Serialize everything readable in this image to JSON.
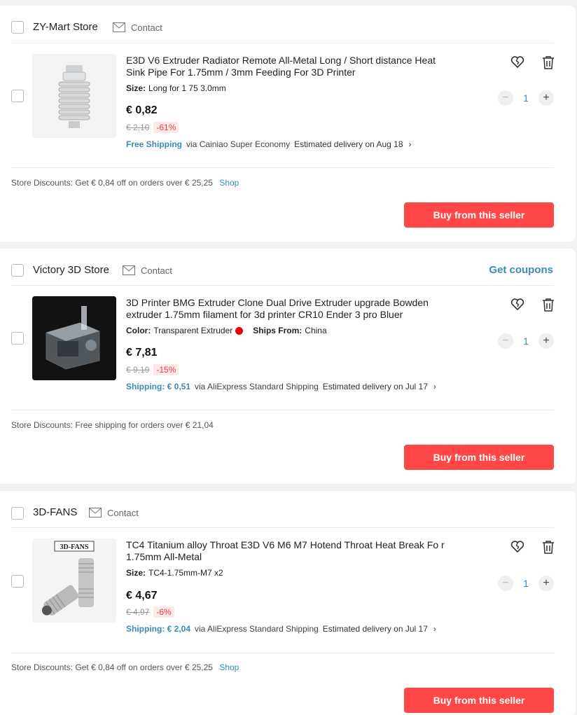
{
  "stores": [
    {
      "name": "ZY-Mart Store",
      "contact_label": "Contact",
      "coupons_label": "",
      "item": {
        "title": "E3D V6 Extruder Radiator Remote All-Metal Long / Short distance Heat Sink Pipe For 1.75mm / 3mm Feeding For 3D Printer",
        "attr1_label": "Size:",
        "attr1_value": "Long for 1 75 3.0mm",
        "attr2_label": "",
        "attr2_value": "",
        "price": "€ 0,82",
        "old_price": "€ 2,10",
        "discount_pct": "-61%",
        "shipping_value": "Free Shipping",
        "shipping_via": "via Cainiao Super Economy",
        "delivery": "Estimated delivery on Aug 18",
        "quantity": "1"
      },
      "store_discount_label": "Store Discounts:",
      "store_discount_text": "Get € 0,84 off on orders over € 25,25",
      "store_discount_link": "Shop",
      "buy_label": "Buy from this seller"
    },
    {
      "name": "Victory 3D Store",
      "contact_label": "Contact",
      "coupons_label": "Get coupons",
      "item": {
        "title": "3D Printer BMG Extruder Clone Dual Drive Extruder upgrade Bowden extruder 1.75mm filament for 3d printer CR10 Ender 3 pro Bluer",
        "attr1_label": "Color:",
        "attr1_value": "Transparent Extruder",
        "attr2_label": "Ships From:",
        "attr2_value": "China",
        "price": "€ 7,81",
        "old_price": "€ 9,19",
        "discount_pct": "-15%",
        "shipping_value": "Shipping: € 0,51",
        "shipping_via": "via AliExpress Standard Shipping",
        "delivery": "Estimated delivery on Jul 17",
        "quantity": "1"
      },
      "store_discount_label": "Store Discounts:",
      "store_discount_text": "Free shipping for orders over € 21,04",
      "store_discount_link": "",
      "buy_label": "Buy from this seller"
    },
    {
      "name": "3D-FANS",
      "contact_label": "Contact",
      "coupons_label": "",
      "item": {
        "title": "TC4 Titanium alloy Throat E3D V6 M6 M7 Hotend Throat Heat Break Fo r 1.75mm All-Metal",
        "attr1_label": "Size:",
        "attr1_value": "TC4-1.75mm-M7 x2",
        "attr2_label": "",
        "attr2_value": "",
        "price": "€ 4,67",
        "old_price": "€ 4,97",
        "discount_pct": "-6%",
        "shipping_value": "Shipping: € 2,04",
        "shipping_via": "via AliExpress Standard Shipping",
        "delivery": "Estimated delivery on Jul 17",
        "quantity": "1",
        "image_logo_text": "3D-FANS"
      },
      "store_discount_label": "Store Discounts:",
      "store_discount_text": "Get € 0,84 off on orders over € 25,25",
      "store_discount_link": "Shop",
      "buy_label": "Buy from this seller"
    }
  ],
  "colors": {
    "accent": "#ff4747",
    "link": "#3a8bb5",
    "discount_red": "#e84141",
    "color_swatch": "#e60000"
  },
  "icons": {
    "contact": "envelope-icon",
    "wishlist": "heart-icon",
    "delete": "trash-icon",
    "chevron": "chevron-right-icon"
  }
}
